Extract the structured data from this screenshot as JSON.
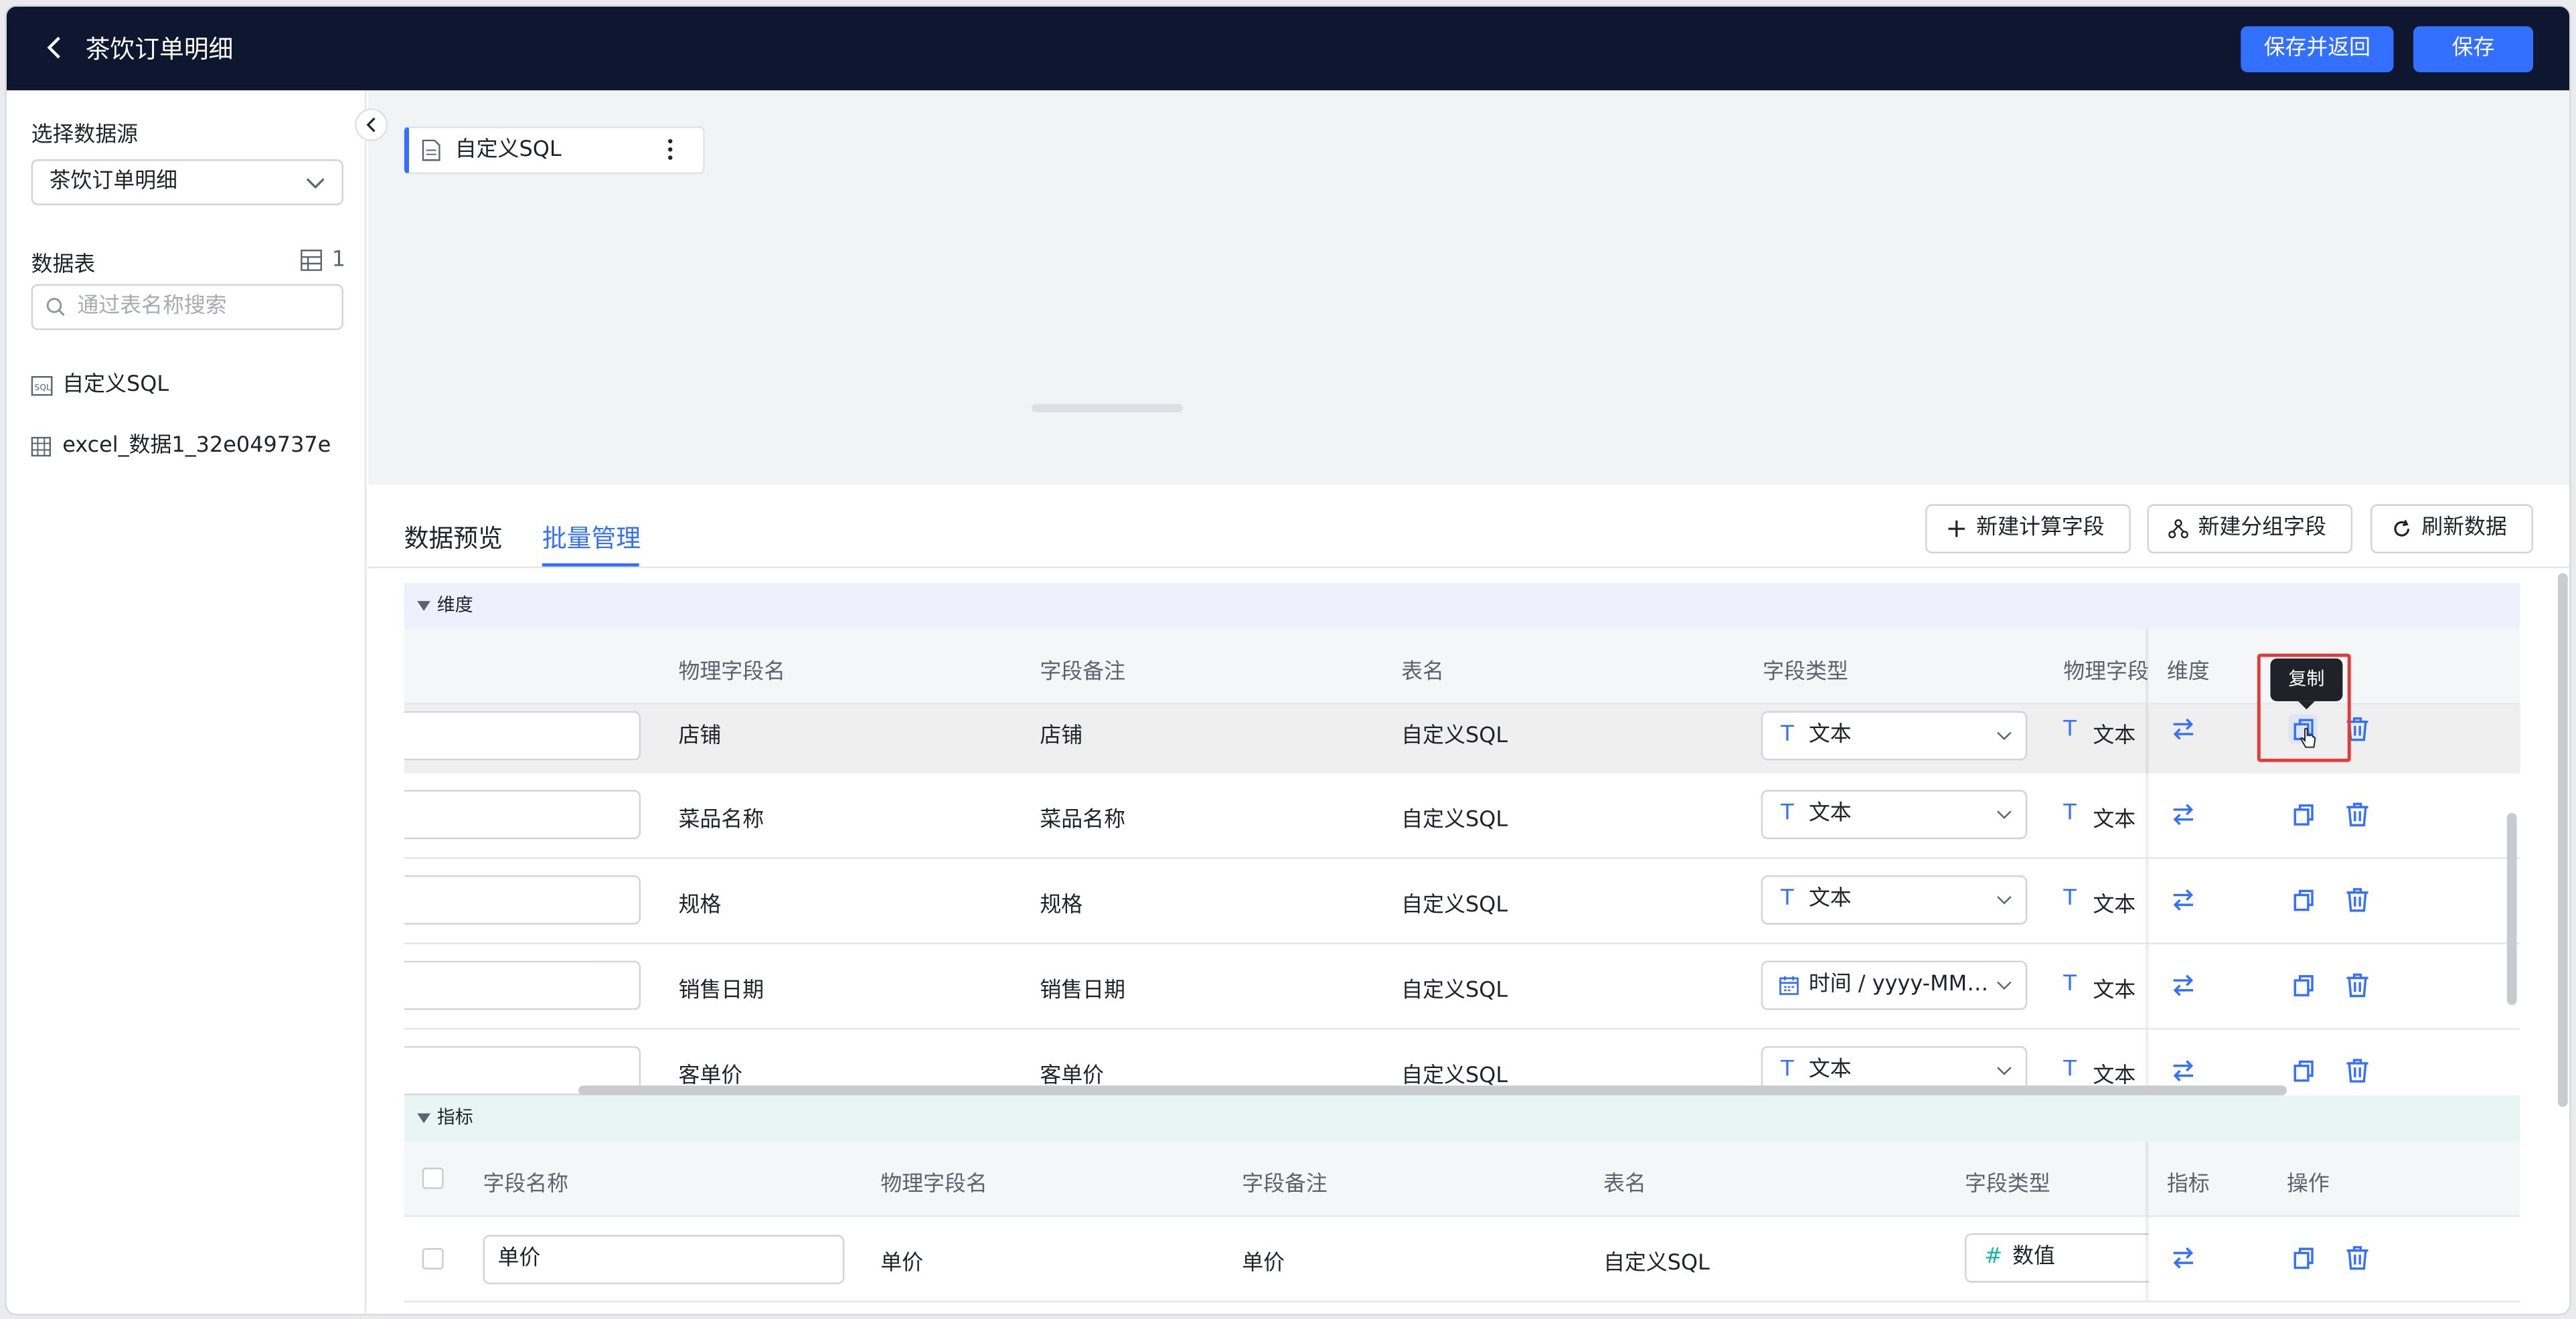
{
  "header": {
    "title": "茶饮订单明细",
    "save_return_label": "保存并返回",
    "save_label": "保存"
  },
  "sidebar": {
    "datasource_label": "选择数据源",
    "datasource_value": "茶饮订单明细",
    "tables_label": "数据表",
    "tables_count": "1",
    "search_placeholder": "通过表名称搜索",
    "tables": [
      {
        "name": "自定义SQL",
        "icon": "sql-icon"
      },
      {
        "name": "excel_数据1_32e049737e",
        "icon": "table-icon"
      }
    ]
  },
  "canvas": {
    "node_label": "自定义SQL"
  },
  "tabs": {
    "preview": "数据预览",
    "batch": "批量管理"
  },
  "actions": {
    "new_calc": "新建计算字段",
    "new_group": "新建分组字段",
    "refresh": "刷新数据"
  },
  "dimensions": {
    "section_label": "维度",
    "columns": {
      "physical": "物理字段名",
      "remark": "字段备注",
      "table": "表名",
      "type": "字段类型",
      "physical_type": "物理字段",
      "dim": "维度"
    },
    "rows": [
      {
        "physical": "店铺",
        "remark": "店铺",
        "table": "自定义SQL",
        "type_icon": "T",
        "type": "文本",
        "ptype": "文本"
      },
      {
        "physical": "菜品名称",
        "remark": "菜品名称",
        "table": "自定义SQL",
        "type_icon": "T",
        "type": "文本",
        "ptype": "文本"
      },
      {
        "physical": "规格",
        "remark": "规格",
        "table": "自定义SQL",
        "type_icon": "T",
        "type": "文本",
        "ptype": "文本"
      },
      {
        "physical": "销售日期",
        "remark": "销售日期",
        "table": "自定义SQL",
        "type_icon": "calendar",
        "type": "时间 / yyyy-MM…",
        "ptype": "文本"
      },
      {
        "physical": "客单价",
        "remark": "客单价",
        "table": "自定义SQL",
        "type_icon": "T",
        "type": "文本",
        "ptype": "文本"
      }
    ],
    "tooltip": "复制"
  },
  "metrics": {
    "section_label": "指标",
    "columns": {
      "name": "字段名称",
      "physical": "物理字段名",
      "remark": "字段备注",
      "table": "表名",
      "type": "字段类型",
      "metric": "指标",
      "ops": "操作"
    },
    "rows": [
      {
        "name": "单价",
        "physical": "单价",
        "remark": "单价",
        "table": "自定义SQL",
        "type_icon": "#",
        "type": "数值"
      }
    ]
  },
  "colors": {
    "header_bg": "#0e1630",
    "primary": "#3370ff",
    "dimension_section": "#eef1fb",
    "metric_section": "#e8f6f3",
    "highlight": "#e53935"
  }
}
